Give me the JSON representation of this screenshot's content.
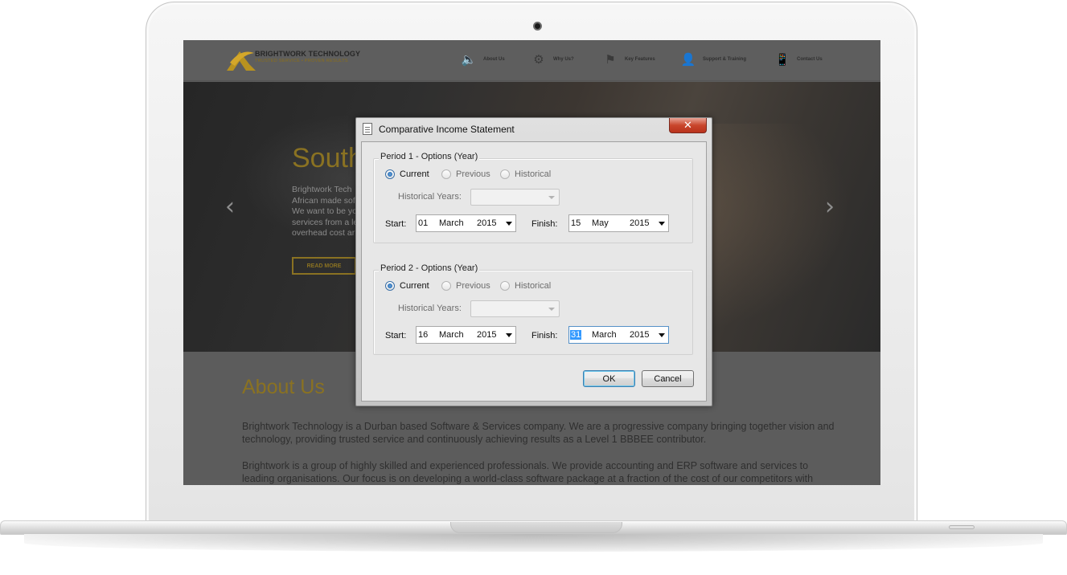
{
  "site": {
    "brand_name": "BRIGHTWORK TECHNOLOGY",
    "brand_tagline": "TRUSTED SERVICE  •  PROVEN RESULTS",
    "nav": [
      {
        "label": "About Us",
        "icon": "speaker-icon"
      },
      {
        "label": "Why Us?",
        "icon": "gears-icon"
      },
      {
        "label": "Key Features",
        "icon": "flag-icon"
      },
      {
        "label": "Support & Training",
        "icon": "person-icon"
      },
      {
        "label": "Contact Us",
        "icon": "phone-icon"
      }
    ],
    "hero": {
      "title": "South",
      "text_lines": [
        "Brightwork Tech",
        "African made sof",
        "We want to be yo",
        "services from a le",
        "overhead cost ar"
      ],
      "button": "READ MORE",
      "prev_arrow": "‹",
      "next_arrow": "›"
    },
    "about": {
      "title": "About Us",
      "paragraph1": "Brightwork Technology is a Durban based Software & Services company. We are a progressive company bringing together vision and technology, providing trusted service and continuously achieving results as a Level 1 BBBEE contributor.",
      "paragraph2": "Brightwork is a group of highly skilled and experienced professionals. We provide accounting and ERP software and services to leading organisations. Our focus is on developing a world-class software package at a fraction of the cost of our competitors with"
    }
  },
  "dialog": {
    "title": "Comparative Income Statement",
    "close_glyph": "✕",
    "period1": {
      "label": "Period 1 - Options (Year)",
      "options": [
        "Current",
        "Previous",
        "Historical"
      ],
      "selected": "Current",
      "historical_years_label": "Historical Years:",
      "historical_years_value": "",
      "start_label": "Start:",
      "start": {
        "day": "01",
        "month": "March",
        "year": "2015"
      },
      "finish_label": "Finish:",
      "finish": {
        "day": "15",
        "month": "May",
        "year": "2015"
      }
    },
    "period2": {
      "label": "Period 2 - Options (Year)",
      "options": [
        "Current",
        "Previous",
        "Historical"
      ],
      "selected": "Current",
      "historical_years_label": "Historical Years:",
      "historical_years_value": "",
      "start_label": "Start:",
      "start": {
        "day": "16",
        "month": "March",
        "year": "2015"
      },
      "finish_label": "Finish:",
      "finish": {
        "day": "31",
        "month": "March",
        "year": "2015"
      }
    },
    "ok_label": "OK",
    "cancel_label": "Cancel"
  }
}
